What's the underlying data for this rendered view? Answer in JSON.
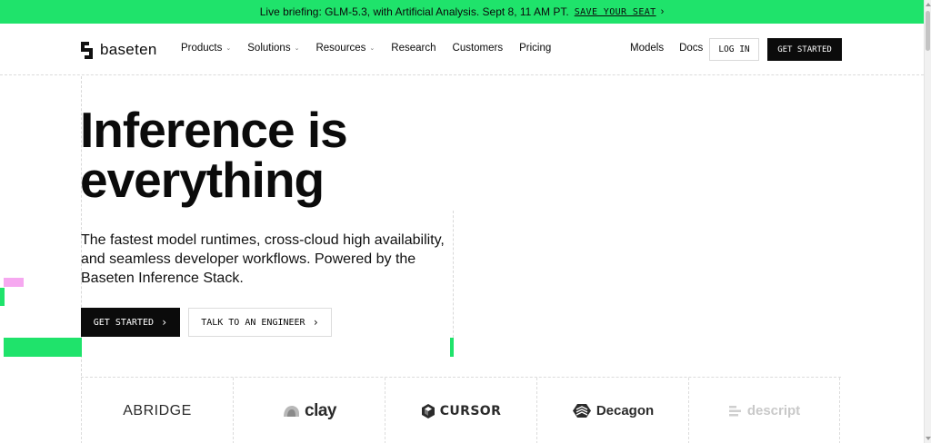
{
  "banner": {
    "text": "Live briefing: GLM-5.3, with Artificial Analysis. Sept 8, 11 AM PT.",
    "cta": "SAVE YOUR SEAT",
    "chevron": "›",
    "background": "#1fe36b"
  },
  "brand": {
    "name": "baseten",
    "icon": "baseten-logo-icon"
  },
  "nav": {
    "items": [
      {
        "label": "Products",
        "has_dropdown": true
      },
      {
        "label": "Solutions",
        "has_dropdown": true
      },
      {
        "label": "Resources",
        "has_dropdown": true
      },
      {
        "label": "Research",
        "has_dropdown": false
      },
      {
        "label": "Customers",
        "has_dropdown": false
      },
      {
        "label": "Pricing",
        "has_dropdown": false
      }
    ],
    "right_items": [
      {
        "label": "Models"
      },
      {
        "label": "Docs"
      }
    ],
    "login_label": "LOG IN",
    "get_started_label": "GET STARTED",
    "caret": "⌄"
  },
  "hero": {
    "headline_line1": "Inference is",
    "headline_line2": "everything",
    "subtext": "The fastest model runtimes, cross-cloud high availability, and seamless developer workflows. Powered by the Baseten Inference Stack.",
    "primary_cta": "GET STARTED",
    "secondary_cta": "TALK TO AN ENGINEER",
    "chevron": "›"
  },
  "customers": [
    {
      "name": "ABRIDGE",
      "icon": ""
    },
    {
      "name": "clay",
      "icon": "clay-logo-icon"
    },
    {
      "name": "CURSOR",
      "icon": "cursor-logo-icon"
    },
    {
      "name": "Decagon",
      "icon": "decagon-logo-icon"
    },
    {
      "name": "descript",
      "icon": "descript-logo-icon"
    }
  ],
  "colors": {
    "accent_green": "#1fe36b",
    "accent_pink": "#f6a8f0",
    "text": "#0b0b0b"
  }
}
